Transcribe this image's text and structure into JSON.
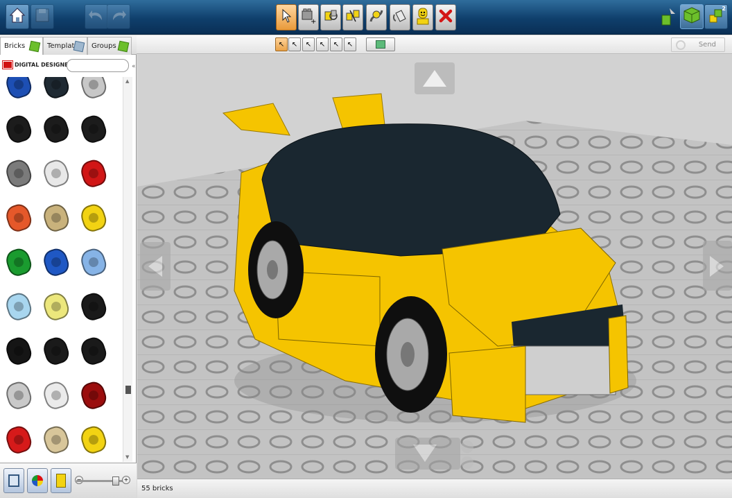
{
  "toolbar": {
    "home_icon": "home-icon",
    "save_icon": "save-icon",
    "undo_icon": "undo-icon",
    "redo_icon": "redo-icon",
    "tools": [
      "select-tool-icon",
      "clone-tool-icon",
      "hinge-tool-icon",
      "hinge-align-tool-icon",
      "flex-tool-icon",
      "paint-bucket-icon",
      "minifig-icon",
      "delete-icon"
    ],
    "right_icons": [
      "build-mode-icon",
      "view-mode-icon",
      "building-guide-icon"
    ],
    "building_guide_badge": "2"
  },
  "subtoolbar": {
    "send_label": "Send",
    "select_tools": [
      "single-select-icon",
      "connected-select-icon",
      "same-color-select-icon",
      "same-shape-select-icon",
      "invert-select-icon",
      "select-all-icon"
    ],
    "hide_icon": "hide-brick-icon"
  },
  "palette": {
    "tabs": [
      {
        "label": "Bricks",
        "icon": "green-brick-icon"
      },
      {
        "label": "Templates",
        "icon": "templates-icon"
      },
      {
        "label": "Groups",
        "icon": "green-brick-icon"
      }
    ],
    "logo_text": "DIGITAL DESIGNER",
    "search_placeholder": "",
    "bricks": [
      [
        "#1d4fb4",
        "#1f2a33",
        "#c7c7c7"
      ],
      [
        "#1c1c1c",
        "#1c1c1c",
        "#1c1c1c"
      ],
      [
        "#7b7b7b",
        "#e8e8e8",
        "#d11616"
      ],
      [
        "#e5582a",
        "#c9b27c",
        "#f2d313"
      ],
      [
        "#1a9b2f",
        "#1f58c4",
        "#86b3e6"
      ],
      [
        "#a8d6ef",
        "#ece77c",
        "#1a1a1a"
      ],
      [
        "#151515",
        "#1a1a1a",
        "#1a1a1a"
      ],
      [
        "#c9c9c9",
        "#ebebeb",
        "#9b0d0d"
      ],
      [
        "#d61a1a",
        "#d8c69a",
        "#f2d313"
      ]
    ],
    "bottom_tools": [
      "palette-view-icon",
      "color-palette-icon",
      "filter-icon"
    ]
  },
  "viewport": {
    "car_body_color": "#f5c400",
    "roof_color": "#1a2730",
    "baseplate_color": "#bfbfbf",
    "camera_controls": [
      "camera-up-icon",
      "camera-left-icon",
      "camera-right-icon",
      "camera-down-icon",
      "zoom-in-icon",
      "zoom-out-icon"
    ]
  },
  "status": {
    "brick_count": "55 bricks"
  }
}
